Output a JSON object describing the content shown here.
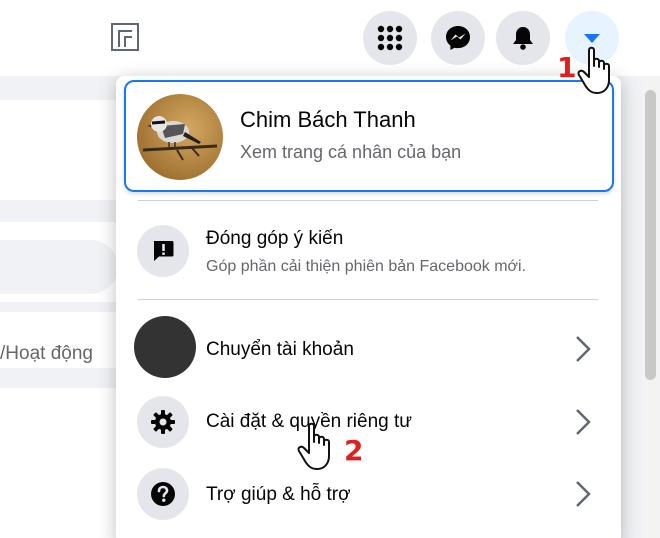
{
  "topbar": {
    "bookmark_icon": "bookmark-square-icon",
    "buttons": [
      {
        "name": "menu-grid-button",
        "icon": "grid-dots-icon"
      },
      {
        "name": "messenger-button",
        "icon": "messenger-icon"
      },
      {
        "name": "notifications-button",
        "icon": "bell-icon"
      },
      {
        "name": "account-button",
        "icon": "caret-down-icon"
      }
    ]
  },
  "background": {
    "activity_label": "/Hoạt động"
  },
  "dropdown": {
    "profile": {
      "name": "Chim Bách Thanh",
      "subtitle": "Xem trang cá nhân của bạn"
    },
    "feedback": {
      "title": "Đóng góp ý kiến",
      "subtitle": "Góp phần cải thiện phiên bản Facebook mới."
    },
    "items": [
      {
        "label": "Chuyển tài khoản"
      },
      {
        "label": "Cài đặt & quyền riêng tư"
      },
      {
        "label": "Trợ giúp & hỗ trợ"
      }
    ]
  },
  "annotations": {
    "step1": "1",
    "step2": "2"
  },
  "colors": {
    "accent": "#1877f2",
    "step_marker": "#e02020",
    "icon_bg": "#e4e6eb"
  }
}
